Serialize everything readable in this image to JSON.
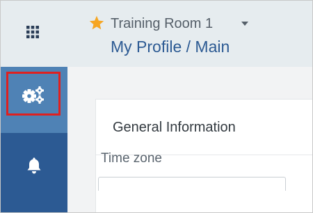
{
  "header": {
    "room_name": "Training Room 1",
    "page_title": "My Profile / Main",
    "favorite_icon": "star-icon",
    "room_dropdown_icon": "caret-down-icon"
  },
  "sidebar": {
    "apps_icon": "grid-icon",
    "items": [
      {
        "name": "settings",
        "icon": "gears-icon",
        "active": true,
        "highlighted": true
      },
      {
        "name": "alerts",
        "icon": "bell-icon",
        "active": false
      }
    ]
  },
  "main": {
    "card_title": "General Information",
    "fields": [
      {
        "label": "Time zone",
        "value": ""
      }
    ]
  },
  "colors": {
    "sidebar": "#2c5a93",
    "sidebar_active": "#4f82b5",
    "header_bg": "#e6ecef",
    "page_title": "#2c5a93",
    "star": "#f6a623",
    "highlight": "#e0201f"
  }
}
